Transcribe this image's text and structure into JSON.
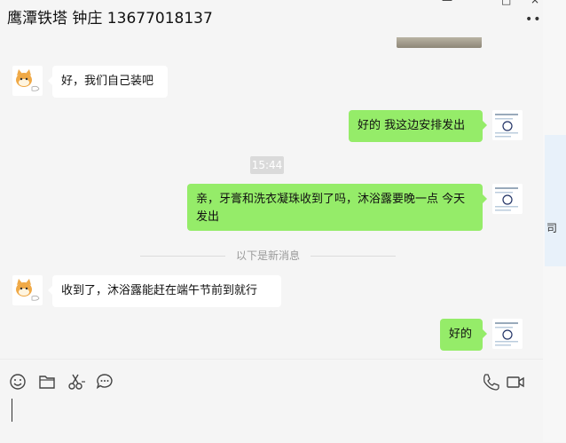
{
  "header": {
    "title": "鹰潭铁塔 钟庄 13677018137",
    "more_label": "•••",
    "minimize_icon": "—",
    "maximize_icon": "□",
    "close_icon": "×"
  },
  "messages": [
    {
      "side": "left",
      "text": "好，我们自己装吧"
    },
    {
      "side": "right",
      "text": "好的 我这边安排发出"
    },
    {
      "time": "15:44"
    },
    {
      "side": "right",
      "text": "亲，牙膏和洗衣凝珠收到了吗，沐浴露要晚一点 今天发出"
    },
    {
      "divider": "以下是新消息"
    },
    {
      "side": "left",
      "text": "收到了，沐浴露能赶在端午节前到就行"
    },
    {
      "side": "right",
      "text": "好的"
    }
  ],
  "right_panel": {
    "text": "司"
  },
  "toolbar": {
    "icons": [
      "emoji-icon",
      "folder-icon",
      "scissors-icon",
      "chat-bubble-icon",
      "phone-icon",
      "video-icon"
    ]
  },
  "colors": {
    "bubble_right": "#95ec69",
    "bubble_left": "#ffffff",
    "background": "#f5f5f5"
  }
}
